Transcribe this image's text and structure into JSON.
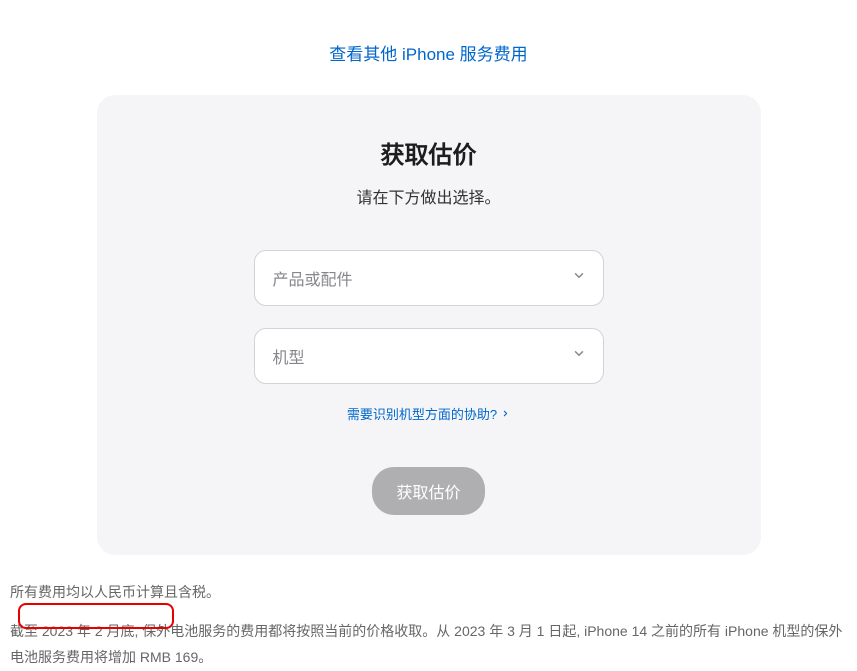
{
  "top_link": "查看其他 iPhone 服务费用",
  "card": {
    "title": "获取估价",
    "subtitle": "请在下方做出选择。",
    "select_product_placeholder": "产品或配件",
    "select_model_placeholder": "机型",
    "help_link": "需要识别机型方面的协助?",
    "submit_label": "获取估价"
  },
  "footer": {
    "line1": "所有费用均以人民币计算且含税。",
    "line2": "截至 2023 年 2 月底, 保外电池服务的费用都将按照当前的价格收取。从 2023 年 3 月 1 日起, iPhone 14 之前的所有 iPhone 机型的保外电池服务费用将增加 RMB 169。"
  }
}
